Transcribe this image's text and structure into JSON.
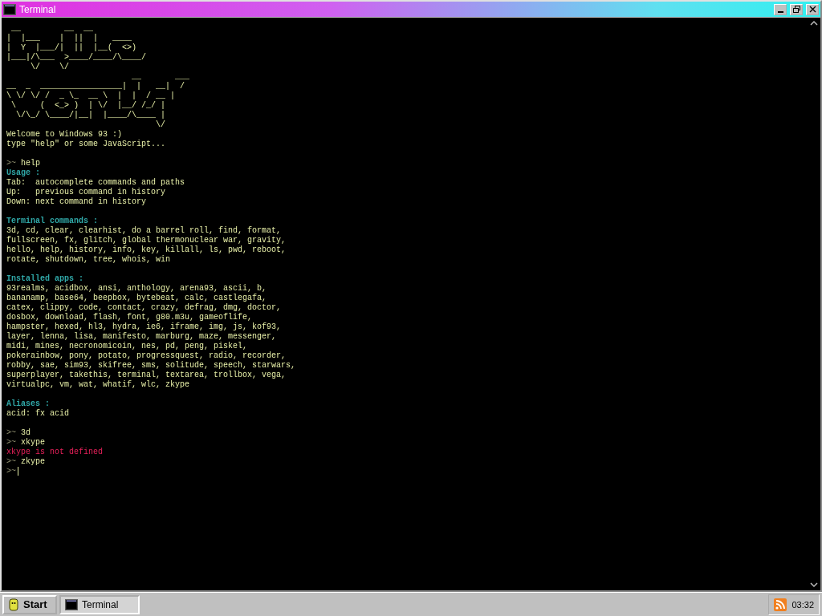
{
  "window": {
    "title": "Terminal"
  },
  "terminal": {
    "banner": [
      " __         __  __",
      "|  |___    |  ||  |   ____",
      "|  Y  |___/|  ||  |__(  <>)",
      "|___|/\\___  >____/____/\\____/",
      "     \\/    \\/",
      "                          __       ___",
      "__  _  _________________|  |   __|  /",
      "\\ \\/ \\/ /  _ \\_  __ \\  |  |  / __ |",
      " \\     (  <_> )  | \\/  |__/ /_/ |",
      "  \\/\\_/ \\____/|__|  |____/\\____ |",
      "                               \\/"
    ],
    "lines": [
      {
        "kind": "text",
        "text": "Welcome to Windows 93 :)"
      },
      {
        "kind": "text",
        "text": "type \"help\" or some JavaScript..."
      },
      {
        "kind": "blank"
      },
      {
        "kind": "prompt",
        "prompt": ">~",
        "text": "help"
      },
      {
        "kind": "heading",
        "text": "Usage :"
      },
      {
        "kind": "text",
        "text": "Tab:  autocomplete commands and paths"
      },
      {
        "kind": "text",
        "text": "Up:   previous command in history"
      },
      {
        "kind": "text",
        "text": "Down: next command in history"
      },
      {
        "kind": "blank"
      },
      {
        "kind": "heading",
        "text": "Terminal commands :"
      },
      {
        "kind": "text",
        "text": "3d, cd, clear, clearhist, do a barrel roll, find, format,"
      },
      {
        "kind": "text",
        "text": "fullscreen, fx, glitch, global thermonuclear war, gravity,"
      },
      {
        "kind": "text",
        "text": "hello, help, history, info, key, killall, ls, pwd, reboot,"
      },
      {
        "kind": "text",
        "text": "rotate, shutdown, tree, whois, win"
      },
      {
        "kind": "blank"
      },
      {
        "kind": "heading",
        "text": "Installed apps :"
      },
      {
        "kind": "text",
        "text": "93realms, acidbox, ansi, anthology, arena93, ascii, b,"
      },
      {
        "kind": "text",
        "text": "bananamp, base64, beepbox, bytebeat, calc, castlegafa,"
      },
      {
        "kind": "text",
        "text": "catex, clippy, code, contact, crazy, defrag, dmg, doctor,"
      },
      {
        "kind": "text",
        "text": "dosbox, download, flash, font, g80.m3u, gameoflife,"
      },
      {
        "kind": "text",
        "text": "hampster, hexed, hl3, hydra, ie6, iframe, img, js, kof93,"
      },
      {
        "kind": "text",
        "text": "layer, lenna, lisa, manifesto, marburg, maze, messenger,"
      },
      {
        "kind": "text",
        "text": "midi, mines, necronomicoin, nes, pd, peng, piskel,"
      },
      {
        "kind": "text",
        "text": "pokerainbow, pony, potato, progressquest, radio, recorder,"
      },
      {
        "kind": "text",
        "text": "robby, sae, sim93, skifree, sms, solitude, speech, starwars,"
      },
      {
        "kind": "text",
        "text": "superplayer, takethis, terminal, textarea, trollbox, vega,"
      },
      {
        "kind": "text",
        "text": "virtualpc, vm, wat, whatif, wlc, zkype"
      },
      {
        "kind": "blank"
      },
      {
        "kind": "heading",
        "text": "Aliases :"
      },
      {
        "kind": "text",
        "text": "acid: fx acid"
      },
      {
        "kind": "blank"
      },
      {
        "kind": "prompt",
        "prompt": ">~",
        "text": "3d"
      },
      {
        "kind": "prompt",
        "prompt": ">~",
        "text": "xkype"
      },
      {
        "kind": "error",
        "text": "xkype is not defined"
      },
      {
        "kind": "prompt",
        "prompt": ">~",
        "text": "zkype"
      },
      {
        "kind": "input",
        "prompt": ">~"
      }
    ]
  },
  "taskbar": {
    "start": "Start",
    "tasks": [
      {
        "label": "Terminal",
        "selected": true
      }
    ],
    "clock": "03:32"
  }
}
